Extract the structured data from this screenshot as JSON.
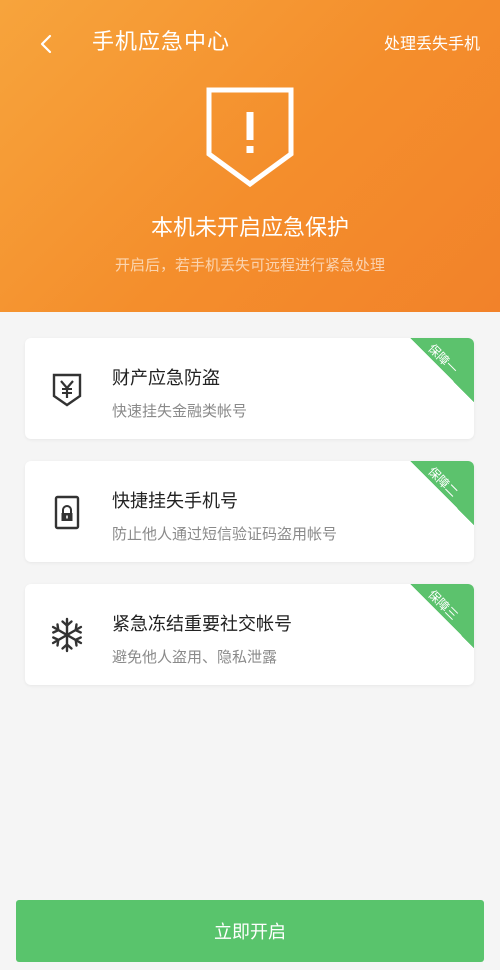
{
  "header": {
    "title": "手机应急中心",
    "right_action": "处理丢失手机"
  },
  "hero": {
    "icon": "shield-exclamation-icon",
    "headline": "本机未开启应急保护",
    "subline": "开启后，若手机丢失可远程进行紧急处理"
  },
  "cards": [
    {
      "icon": "yen-shield-icon",
      "title": "财产应急防盗",
      "subtitle": "快速挂失金融类帐号",
      "tag": "保障一"
    },
    {
      "icon": "sim-lock-icon",
      "title": "快捷挂失手机号",
      "subtitle": "防止他人通过短信验证码盗用帐号",
      "tag": "保障二"
    },
    {
      "icon": "snowflake-icon",
      "title": "紧急冻结重要社交帐号",
      "subtitle": "避免他人盗用、隐私泄露",
      "tag": "保障三"
    }
  ],
  "primary_button": {
    "label": "立即开启"
  },
  "colors": {
    "hero_gradient_start": "#f7a43c",
    "hero_gradient_end": "#f2822a",
    "accent_green": "#59c46c",
    "background": "#f5f5f5"
  }
}
